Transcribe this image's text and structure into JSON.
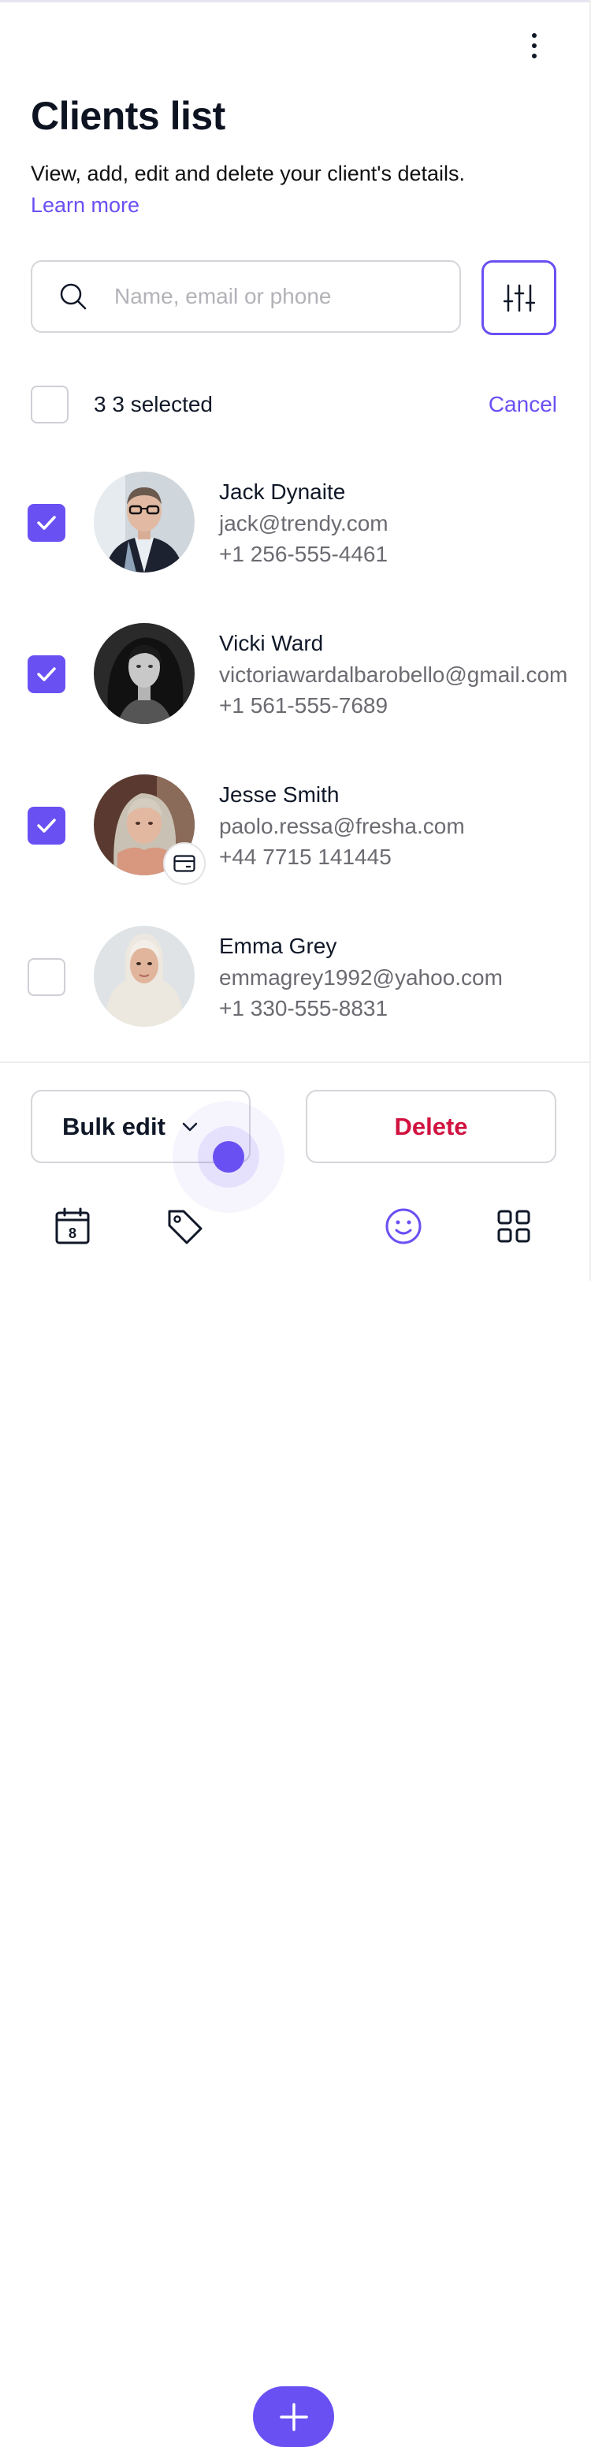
{
  "header": {
    "title": "Clients list",
    "subtitle": "View, add, edit and delete your client's details.",
    "learn_more": "Learn more",
    "menu_icon": "more-vertical-icon"
  },
  "search": {
    "placeholder": "Name, email or phone",
    "icon": "search-icon",
    "filter_icon": "sliders-icon"
  },
  "selection": {
    "label": "3 3 selected",
    "cancel": "Cancel"
  },
  "clients": [
    {
      "name": "Jack Dynaite",
      "email": "jack@trendy.com",
      "phone": "+1 256-555-4461",
      "checked": true
    },
    {
      "name": "Vicki Ward",
      "email": "victoriawardalbarobello@gmail.com",
      "phone": "+1 561-555-7689",
      "checked": true
    },
    {
      "name": "Jesse Smith",
      "email": "paolo.ressa@fresha.com",
      "phone": "+44 7715 141445",
      "checked": true,
      "badge": "card-icon"
    },
    {
      "name": "Emma Grey",
      "email": "emmagrey1992@yahoo.com",
      "phone": "+1 330-555-8831",
      "checked": false
    }
  ],
  "actions": {
    "bulk_edit": "Bulk edit",
    "delete": "Delete"
  },
  "bottom_nav": {
    "items": [
      "calendar-icon",
      "tag-icon",
      "plus-icon",
      "smile-icon",
      "grid-icon"
    ],
    "calendar_day": "8",
    "active": "smile-icon"
  },
  "colors": {
    "accent": "#6950f3",
    "danger": "#d1123f",
    "text": "#101828",
    "muted": "#6b6b72"
  }
}
